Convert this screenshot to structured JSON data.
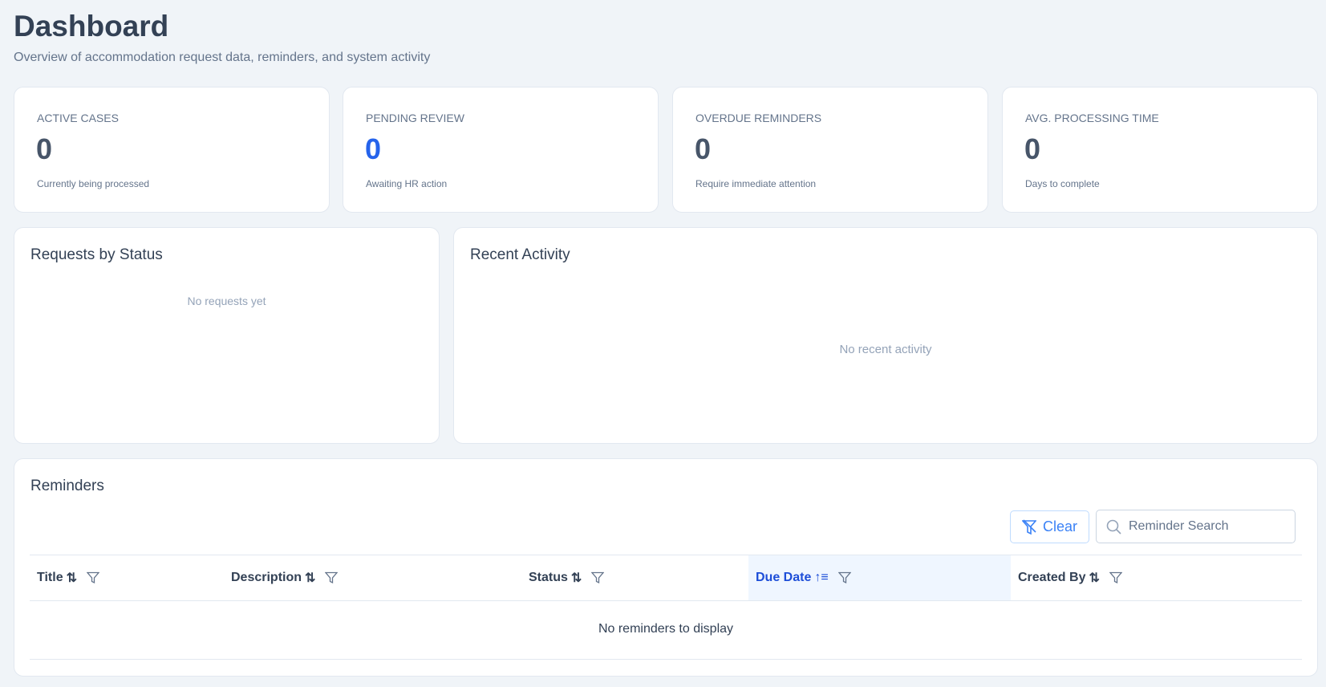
{
  "header": {
    "title": "Dashboard",
    "subtitle": "Overview of accommodation request data, reminders, and system activity"
  },
  "stats": [
    {
      "label": "ACTIVE CASES",
      "value": "0",
      "desc": "Currently being processed"
    },
    {
      "label": "PENDING REVIEW",
      "value": "0",
      "desc": "Awaiting HR action"
    },
    {
      "label": "OVERDUE REMINDERS",
      "value": "0",
      "desc": "Require immediate attention"
    },
    {
      "label": "AVG. PROCESSING TIME",
      "value": "0",
      "desc": "Days to complete"
    }
  ],
  "requests_by_status": {
    "title": "Requests by Status",
    "empty": "No requests yet"
  },
  "recent_activity": {
    "title": "Recent Activity",
    "empty": "No recent activity"
  },
  "reminders": {
    "title": "Reminders",
    "clear_label": "Clear",
    "search_placeholder": "Reminder Search",
    "columns": [
      "Title",
      "Description",
      "Status",
      "Due Date",
      "Created By"
    ],
    "empty": "No reminders to display"
  },
  "colors": {
    "accent": "#2563eb",
    "sorted_bg": "#eff6ff"
  }
}
